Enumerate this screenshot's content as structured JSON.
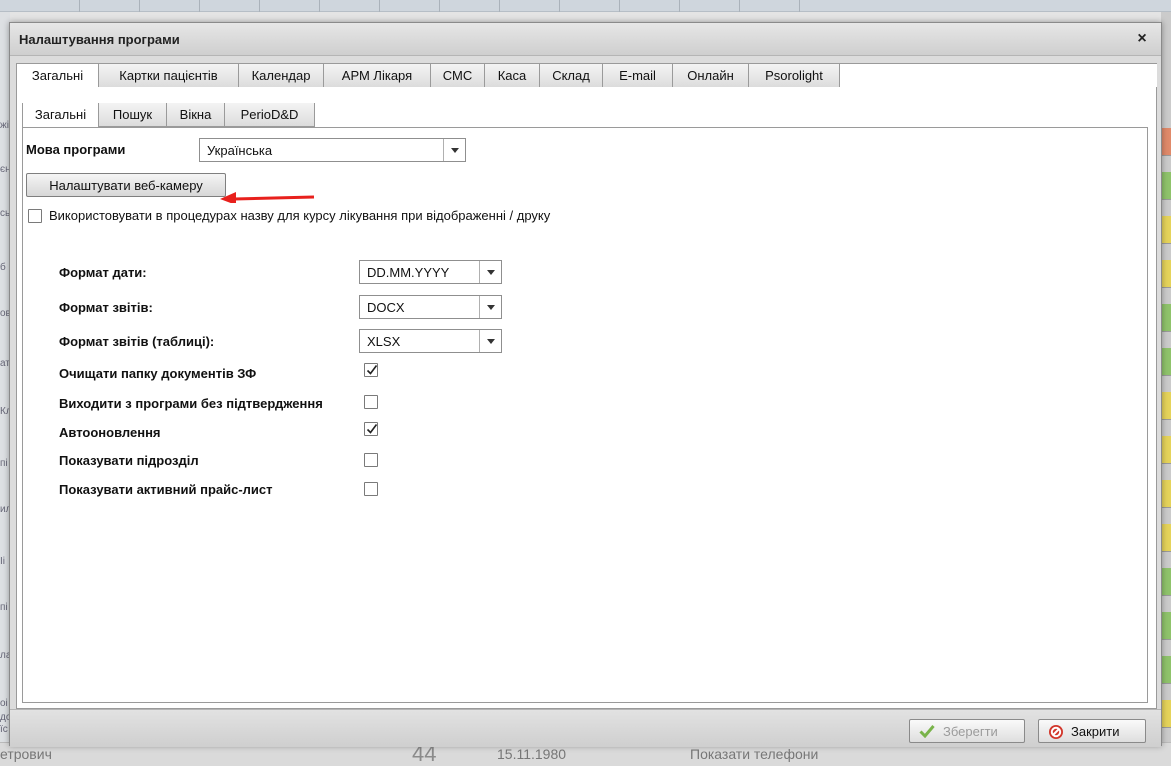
{
  "background": {
    "left_glyphs": [
      "жі",
      "єн",
      "сь",
      "б",
      "ов",
      "ат",
      "Кл",
      "пі",
      "ил",
      "Іі",
      "пі",
      "ла",
      "оі",
      "до",
      "їс",
      "ета"
    ],
    "bottom_texts": [
      "44",
      "15.11.1980",
      "Показати телефони",
      "етрович"
    ]
  },
  "dialog": {
    "title": "Налаштування програми",
    "close_glyph": "×",
    "main_tabs": [
      {
        "label": "Загальні"
      },
      {
        "label": "Картки пацієнтів"
      },
      {
        "label": "Календар"
      },
      {
        "label": "АРМ Лікаря"
      },
      {
        "label": "СМС"
      },
      {
        "label": "Каса"
      },
      {
        "label": "Склад"
      },
      {
        "label": "E-mail"
      },
      {
        "label": "Онлайн"
      },
      {
        "label": "Psorolight"
      }
    ],
    "sub_tabs": [
      {
        "label": "Загальні"
      },
      {
        "label": "Пошук"
      },
      {
        "label": "Вікна"
      },
      {
        "label": "PerioD&D"
      }
    ],
    "language_label": "Мова програми",
    "language_value": "Українська",
    "webcam_button": "Налаштувати веб-камеру",
    "course_name_checkbox_label": "Використовувати в процедурах назву для курсу лікування при відображенні / друку",
    "course_name_checked": false,
    "date_format_label": "Формат дати:",
    "date_format_value": "DD.MM.YYYY",
    "report_format_label": "Формат звітів:",
    "report_format_value": "DOCX",
    "table_report_format_label": "Формат звітів (таблиці):",
    "table_report_format_value": "XLSX",
    "options": [
      {
        "label": "Очищати папку документів ЗФ",
        "checked": true
      },
      {
        "label": "Виходити з програми без підтвердження",
        "checked": false
      },
      {
        "label": "Автооновлення",
        "checked": true
      },
      {
        "label": "Показувати підрозділ",
        "checked": false
      },
      {
        "label": "Показувати активний прайс-лист",
        "checked": false
      }
    ],
    "save_button": "Зберегти",
    "close_button": "Закрити"
  },
  "colors": {
    "annotation_arrow": "#e8201c",
    "save_icon": "#79b34a",
    "close_icon": "#d2372b"
  }
}
